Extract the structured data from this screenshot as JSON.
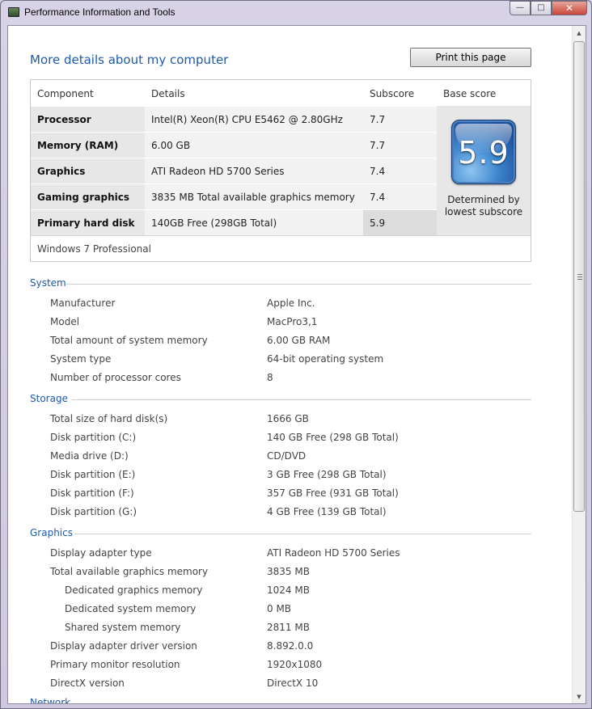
{
  "window": {
    "title": "Performance Information and Tools",
    "minimize": "—",
    "maximize": "□",
    "close": "✕"
  },
  "page": {
    "title": "More details about my computer",
    "print_button": "Print this page"
  },
  "score_table": {
    "headers": [
      "Component",
      "Details",
      "Subscore",
      "Base score"
    ],
    "rows": [
      {
        "component": "Processor",
        "details": "Intel(R) Xeon(R) CPU E5462 @ 2.80GHz",
        "subscore": "7.7"
      },
      {
        "component": "Memory (RAM)",
        "details": "6.00 GB",
        "subscore": "7.7"
      },
      {
        "component": "Graphics",
        "details": "ATI Radeon HD 5700 Series",
        "subscore": "7.4"
      },
      {
        "component": "Gaming graphics",
        "details": "3835 MB Total available graphics memory",
        "subscore": "7.4"
      },
      {
        "component": "Primary hard disk",
        "details": "140GB Free (298GB Total)",
        "subscore": "5.9"
      }
    ],
    "base_score": "5.9",
    "base_caption_1": "Determined by",
    "base_caption_2": "lowest subscore",
    "os": "Windows 7 Professional"
  },
  "system": {
    "title": "System",
    "items": [
      {
        "label": "Manufacturer",
        "value": "Apple Inc."
      },
      {
        "label": "Model",
        "value": "MacPro3,1"
      },
      {
        "label": "Total amount of system memory",
        "value": "6.00 GB RAM"
      },
      {
        "label": "System type",
        "value": "64-bit operating system"
      },
      {
        "label": "Number of processor cores",
        "value": "8"
      }
    ]
  },
  "storage": {
    "title": "Storage",
    "items": [
      {
        "label": "Total size of hard disk(s)",
        "value": "1666 GB"
      },
      {
        "label": "Disk partition (C:)",
        "value": "140 GB Free (298 GB Total)"
      },
      {
        "label": "Media drive (D:)",
        "value": "CD/DVD"
      },
      {
        "label": "Disk partition (E:)",
        "value": "3 GB Free (298 GB Total)"
      },
      {
        "label": "Disk partition (F:)",
        "value": "357 GB Free (931 GB Total)"
      },
      {
        "label": "Disk partition (G:)",
        "value": "4 GB Free (139 GB Total)"
      }
    ]
  },
  "graphics": {
    "title": "Graphics",
    "items": [
      {
        "label": "Display adapter type",
        "value": "ATI Radeon HD 5700 Series"
      },
      {
        "label": "Total available graphics memory",
        "value": "3835 MB"
      },
      {
        "label": "Dedicated graphics memory",
        "value": "1024 MB"
      },
      {
        "label": "Dedicated system memory",
        "value": "0 MB"
      },
      {
        "label": "Shared system memory",
        "value": "2811 MB"
      },
      {
        "label": "Display adapter driver version",
        "value": "8.892.0.0"
      },
      {
        "label": "Primary monitor resolution",
        "value": "1920x1080"
      },
      {
        "label": "DirectX version",
        "value": "DirectX 10"
      }
    ]
  },
  "next_section_clipped": "Network"
}
